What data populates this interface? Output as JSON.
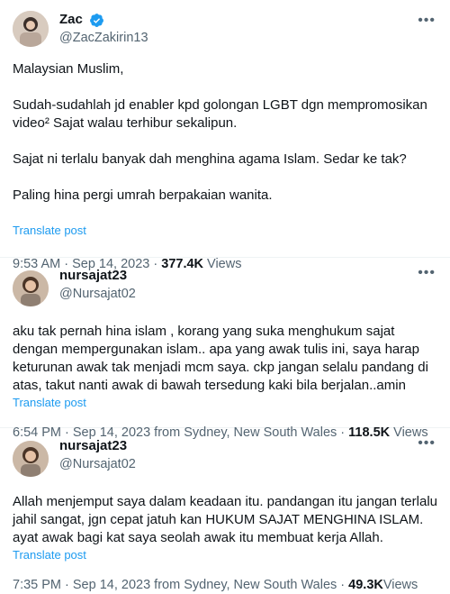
{
  "posts": [
    {
      "display_name": "Zac",
      "handle": "@ZacZakirin13",
      "verified": true,
      "paragraphs": [
        "Malaysian Muslim,",
        "Sudah-sudahlah jd enabler kpd golongan LGBT dgn mempromosikan video² Sajat walau terhibur sekalipun.",
        "Sajat ni terlalu banyak dah menghina agama Islam. Sedar ke tak?",
        "Paling hina pergi umrah berpakaian wanita."
      ],
      "translate": "Translate post",
      "timestamp": "9:53 AM · Sep 14, 2023 · ",
      "views_count": "377.4K",
      "views_label": " Views"
    },
    {
      "display_name": "nursajat23",
      "handle": "@Nursajat02",
      "verified": false,
      "paragraphs": [
        "aku tak pernah hina islam , korang yang suka  menghukum sajat dengan mempergunakan islam.. apa yang awak tulis ini, saya harap keturunan awak tak menjadi mcm saya. ckp jangan selalu pandang di atas, takut nanti awak di bawah tersedung kaki bila berjalan..amin"
      ],
      "translate": "Translate post",
      "timestamp": "6:54 PM · Sep 14, 2023 from Sydney, New South Wales · ",
      "views_count": "118.5K",
      "views_label": " Views"
    },
    {
      "display_name": "nursajat23",
      "handle": "@Nursajat02",
      "verified": false,
      "paragraphs": [
        "Allah menjemput saya dalam keadaan itu. pandangan itu jangan terlalu jahil sangat, jgn cepat jatuh kan HUKUM SAJAT MENGHINA ISLAM. ayat awak bagi kat saya  seolah awak itu membuat kerja Allah."
      ],
      "translate": "Translate post",
      "timestamp": "7:35 PM · Sep 14, 2023 from Sydney, New South Wales · ",
      "views_count": "49.3K",
      "views_label": "Views"
    }
  ],
  "colors": {
    "text": "#0f1419",
    "secondary": "#536471",
    "link": "#1d9bf0",
    "verified": "#1d9bf0"
  },
  "icons": {
    "verified": "verified-badge-icon",
    "more": "more-horizontal-icon"
  }
}
